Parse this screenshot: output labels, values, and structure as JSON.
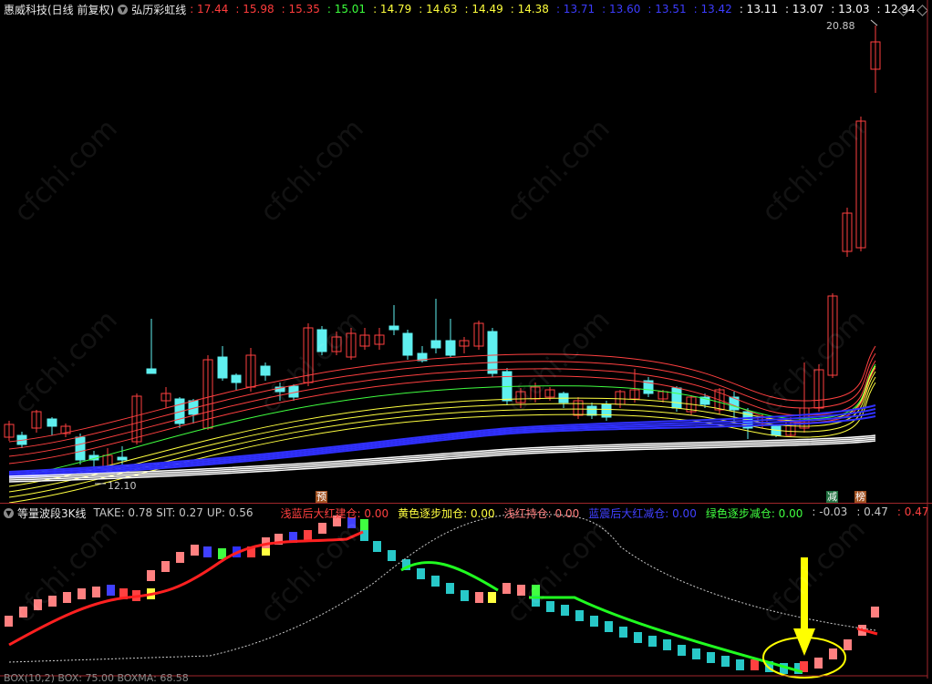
{
  "top_header": {
    "stock": "惠威科技(日线 前复权)",
    "indicator": "弘历彩虹线",
    "values": [
      {
        "v": ": 17.44",
        "c": "#ff3c3c"
      },
      {
        "v": ": 15.98",
        "c": "#ff3c3c"
      },
      {
        "v": ": 15.35",
        "c": "#ff3c3c"
      },
      {
        "v": ": 15.01",
        "c": "#3cff3c"
      },
      {
        "v": ": 14.79",
        "c": "#ffff3c"
      },
      {
        "v": ": 14.63",
        "c": "#ffff3c"
      },
      {
        "v": ": 14.49",
        "c": "#ffff3c"
      },
      {
        "v": ": 14.38",
        "c": "#ffff3c"
      },
      {
        "v": ": 13.71",
        "c": "#3c3cff"
      },
      {
        "v": ": 13.60",
        "c": "#3c3cff"
      },
      {
        "v": ": 13.51",
        "c": "#3c3cff"
      },
      {
        "v": ": 13.42",
        "c": "#3c3cff"
      },
      {
        "v": ": 13.11",
        "c": "#ffffff"
      },
      {
        "v": ": 13.07",
        "c": "#ffffff"
      },
      {
        "v": ": 13.03",
        "c": "#ffffff"
      },
      {
        "v": ": 12.94",
        "c": "#ffffff"
      }
    ]
  },
  "price_labels": {
    "high": "20.88",
    "low": "12.10"
  },
  "signals": {
    "pre": "预",
    "reduce": "减",
    "rank": "榜"
  },
  "bottom_header": {
    "indicator": "等量波段3K线",
    "take": "TAKE: 0.78",
    "sit": "SIT: 0.27",
    "up": "UP: 0.56",
    "items": [
      {
        "t": "浅蓝后大红建仓: 0.00",
        "c": "#ff4040"
      },
      {
        "t": "黄色逐步加仓: 0.00",
        "c": "#ffff40"
      },
      {
        "t": "浅红持仓: 0.00",
        "c": "#ff8080"
      },
      {
        "t": "蓝震后大红减仓: 0.00",
        "c": "#4040ff"
      },
      {
        "t": "绿色逐步减仓: 0.00",
        "c": "#40ff40"
      },
      {
        "t": ": -0.03",
        "c": "#c8c8c8"
      },
      {
        "t": ": 0.47",
        "c": "#c8c8c8"
      },
      {
        "t": ": 0.47",
        "c": "#ff4040"
      }
    ]
  },
  "bottom_strip": "BOX(10,2)  BOX: 75.00  BOXMA: 68.58",
  "watermark": "cfchi.com",
  "colors": {
    "bg": "#000000",
    "axis": "#a0262b",
    "up": "#ff4040",
    "down": "#5ff0f0"
  }
}
